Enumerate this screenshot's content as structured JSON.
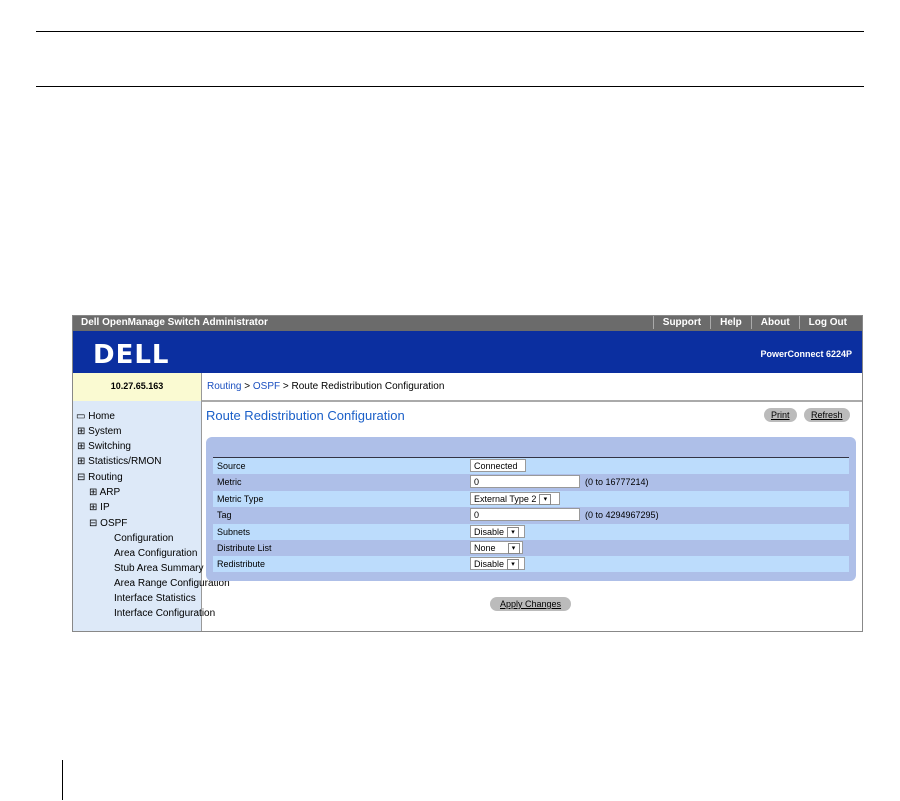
{
  "app": {
    "title": "Dell OpenManage Switch Administrator",
    "links": [
      "Support",
      "Help",
      "About",
      "Log Out"
    ],
    "logo": "DELL",
    "model": "PowerConnect 6224P",
    "ip": "10.27.65.163"
  },
  "breadcrumb": [
    "Routing",
    "OSPF",
    "Route Redistribution Configuration"
  ],
  "nav": [
    "Home",
    "System",
    "Switching",
    "Statistics/RMON",
    "Routing",
    "ARP",
    "IP",
    "OSPF",
    "Configuration",
    "Area Configuration",
    "Stub Area Summary",
    "Area Range Configuration",
    "Interface Statistics",
    "Interface Configuration"
  ],
  "page": {
    "title": "Route Redistribution Configuration",
    "print": "Print",
    "refresh": "Refresh",
    "apply": "Apply Changes"
  },
  "rows": [
    {
      "label": "Source",
      "value": "Connected",
      "type": "select"
    },
    {
      "label": "Metric",
      "value": "0",
      "type": "input",
      "hint": "(0 to 16777214)"
    },
    {
      "label": "Metric Type",
      "value": "External Type 2",
      "type": "select"
    },
    {
      "label": "Tag",
      "value": "0",
      "type": "input",
      "hint": "(0 to 4294967295)"
    },
    {
      "label": "Subnets",
      "value": "Disable",
      "type": "select"
    },
    {
      "label": "Distribute List",
      "value": "None",
      "type": "select"
    },
    {
      "label": "Redistribute",
      "value": "Disable",
      "type": "select"
    }
  ]
}
